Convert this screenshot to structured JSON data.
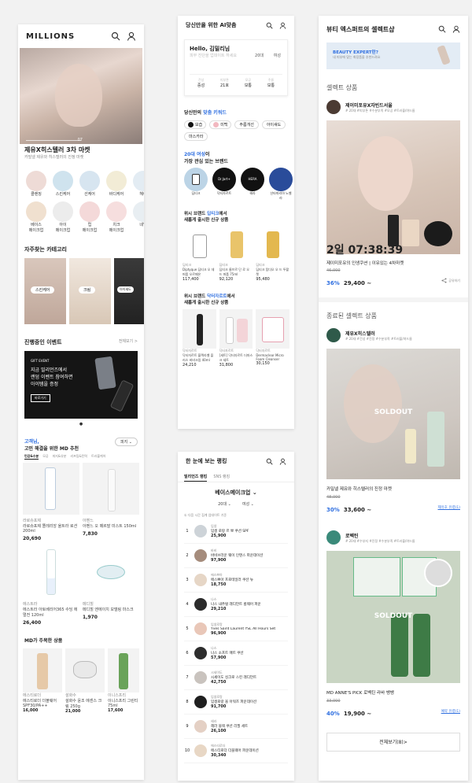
{
  "p1": {
    "brand": "MILLIONS",
    "hero_pg": "07",
    "hero_title": "제유X히스텔러 3차 마켓",
    "hero_sub": "카밀넬 제유와 히스텔러의 진정 마켓",
    "cats1": [
      "클렌징",
      "스킨케어",
      "선케어",
      "바디케어",
      "헤어"
    ],
    "cats2": [
      "베이스\n메이크업",
      "아이\n메이크업",
      "립\n메이크업",
      "치크\n메이크업",
      "네일"
    ],
    "fav_title": "자주찾는 카테고리",
    "fav": [
      "스킨케어",
      "크림",
      "아이섀도"
    ],
    "event_title": "진행중인 이벤트",
    "event_more": "전체보기 >",
    "event_tag": "GIFT EVENT",
    "event_l1": "지금 밀리언즈에서",
    "event_l2": "랜덤 이벤트 참여하면",
    "event_l3": "아이템을 증정",
    "event_btn": "바로가기",
    "md_title1": "고객님,",
    "md_title2": "고민 해결을 위한 MD 추천",
    "md_select": "피지 ⌄",
    "tabs": [
      "민감&수분",
      "모공",
      "피지&유분",
      "리프팅&탄력",
      "트러블케어"
    ],
    "mdp": [
      {
        "brand": "라로슈포제",
        "name": "라로슈포제 똘레리앙 울트라 로션 200ml",
        "price": "20,690"
      },
      {
        "brand": "아벤느",
        "name": "아벤느 오 떼르말 미스트 150ml",
        "price": "7,830"
      },
      {
        "brand": "에스트라",
        "name": "에스트라 아토베리어365 수딩 에멀전 120ml",
        "price": "26,400"
      },
      {
        "brand": "메디힐",
        "name": "메디힐 엔에이치 모델링 마스크",
        "price": "1,970"
      }
    ],
    "md2_title": "MD가 주목한 상품",
    "mdp2": [
      {
        "brand": "에스티로더",
        "name": "에스티로더 더블웨어 SPF30/PA++",
        "price": "16,000"
      },
      {
        "brand": "설화수",
        "name": "설화수 윤조 에센스 크림 250g",
        "price": "21,000"
      },
      {
        "brand": "이니스프리",
        "name": "이니스프리 그린티 75ml",
        "price": "17,600"
      }
    ]
  },
  "p2": {
    "title": "당신만을 위한 AI맞춤",
    "hello": "Hello, 김밀리님",
    "hello_sub": "피부 진단을 업데이트 하세요",
    "age": "20대",
    "sex": "여성",
    "stats": [
      {
        "k": "건성",
        "v": "중성"
      },
      {
        "k": "피부톤",
        "v": "21호"
      },
      {
        "k": "모공",
        "v": "보통"
      },
      {
        "k": "주름",
        "v": "보통"
      }
    ],
    "kw_title_a": "당신만의 ",
    "kw_title_b": "맞춤 키워드",
    "kw": [
      "보습",
      "미백",
      "주름개선",
      "아이섀도",
      "마스카라"
    ],
    "br_title_a": "20대 여성",
    "br_title_b": "이",
    "br_title_c": "가장 관심 있는 브랜드",
    "brands": [
      "딥티크",
      "닥터자르트",
      "헤라",
      "산타마리아 노벨라"
    ],
    "b1_title_a": "위시 브랜드 ",
    "b1_title_b": "딥티크",
    "b1_title_c": "에서",
    "b1_title_d": "새롭게 출시한 신규 상품",
    "b1": [
      {
        "brand": "딥티크",
        "name": "Diptyque 딥티크 오 데 퍼퓸 오르페온",
        "price": "117,400"
      },
      {
        "brand": "딥티크",
        "name": "딥티크 롬브르 단 로 오 드 퍼퓸 75ml",
        "price": "92,120"
      },
      {
        "brand": "딥티크",
        "name": "딥티크 탐다오 오 드 뚜왈렛",
        "price": "95,480"
      }
    ],
    "b2_title_a": "위시 브랜드 ",
    "b2_title_b": "닥터자르트",
    "b2_title_c": "에서",
    "b2_title_d": "새롭게 출시한 신규 상품",
    "b2": [
      {
        "brand": "닥터자르트",
        "name": "닥터자르트 블랙라벨 플러스 비비크림 40ml",
        "price": "24,210"
      },
      {
        "brand": "닥터자르트",
        "name": "[세트] 닥터자르트 더마스크 세트",
        "price": "31,800"
      },
      {
        "brand": "닥터자르트",
        "name": "Dermaclear Micro Foam Cleanser",
        "price": "30,150"
      }
    ]
  },
  "p3": {
    "title": "한 눈에 보는 랭킹",
    "tabs": [
      "밀리언즈 랭킹",
      "SNS 랭킹"
    ],
    "cat": "베이스메이크업 ⌄",
    "f1": "20대 ⌄",
    "f2": "여성 ⌄",
    "note": "① 다음 시간 집계 업데이트 기준",
    "rank": [
      {
        "n": "1",
        "brand": "입생",
        "name": "입생 로랑 르 뽀 쿠션 SPF",
        "price": "25,900"
      },
      {
        "n": "2",
        "brand": "바비",
        "name": "바비브라운 웨이 인텐스 파운데이션",
        "price": "97,900"
      },
      {
        "n": "3",
        "brand": "에스쁘아",
        "name": "에스쁘아 프로테일러 쿠션 뉴",
        "price": "18,750"
      },
      {
        "n": "4",
        "brand": "나스",
        "name": "나스 내추럴 래디언트 롱웨어 파운",
        "price": "29,210"
      },
      {
        "n": "5",
        "brand": "입생로랑",
        "name": "Yves Saint Laurent YSL All Hours Set",
        "price": "96,900"
      },
      {
        "n": "6",
        "brand": "나스",
        "name": "나스 소프트 매트 쿠션",
        "price": "57,900"
      },
      {
        "n": "7",
        "brand": "시세이도",
        "name": "시세이도 싱크로 스킨 래디언트",
        "price": "42,750"
      },
      {
        "n": "8",
        "brand": "입생로랑",
        "name": "입생로랑 올 아워즈 파운데이션",
        "price": "91,700"
      },
      {
        "n": "9",
        "brand": "헤라",
        "name": "헤라 블랙 쿠션 리필 세트",
        "price": "26,100"
      },
      {
        "n": "10",
        "brand": "에스티로더",
        "name": "에스티로더 더블웨어 파운데이션",
        "price": "30,340"
      }
    ]
  },
  "p4": {
    "title": "뷰티 엑스퍼트의 셀렉트샵",
    "banner_a": "BEAUTY EXPERT란?",
    "banner_b": "내 피부에 맞는 화장품을 추천드려요",
    "sel_title": "셀렉트 상품",
    "e1": {
      "name": "제이미포유X자빈드서울",
      "tags": "# 20대 #피부톤 #수분부족 #모공 #트러블/여드름"
    },
    "timer": "2일 07:38:39",
    "item1": "제이미포유의 인생쿠션 | 이유있는 4차마켓",
    "old1": "46,000",
    "pct1": "36%",
    "price1": "29,400 ~",
    "share": "공유하기",
    "closed_title": "종료된 셀렉트 상품",
    "e2": {
      "name": "제유X히스텔러",
      "tags": "# 20대 #건성 #진정 #수분부족 #트러블/여드름"
    },
    "soldout": "SOLDOUT",
    "item2": "카밀넬 제유와 히스텔러의 진정 마켓",
    "old2": "48,000",
    "pct2": "30%",
    "price2": "33,600 ~",
    "link2": "제유호 유령(1)",
    "e3": {
      "name": "로벡틴",
      "tags": "# 20대 #수부지 #진정 #수분부족 #트러블/여드름"
    },
    "item3": "MD ANNE'S PICK 로벡틴 라바 뱅뱅",
    "old3": "33,000",
    "pct3": "40%",
    "price3": "19,900 ~",
    "link3": "예약 유령(1)",
    "all": "전체보기(8)>"
  },
  "icons": [
    "search-icon",
    "user-icon"
  ]
}
